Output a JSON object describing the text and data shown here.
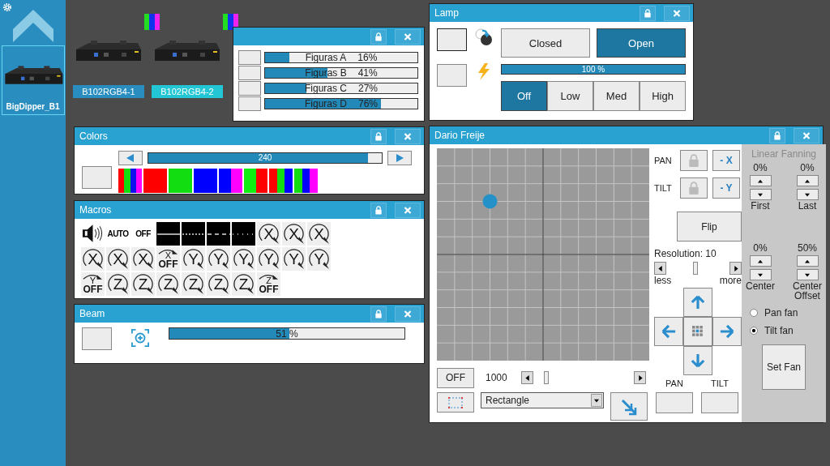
{
  "sidebar": {
    "items": [
      {
        "label": "BigDipper_B1",
        "selected": true
      }
    ]
  },
  "fixtures": [
    {
      "label": "B102RGB4-1",
      "selected": false,
      "stripes": [
        {
          "color": "#22dd22"
        },
        {
          "color": "#1133ee"
        },
        {
          "color": "#ee22ee"
        }
      ]
    },
    {
      "label": "B102RGB4-2",
      "selected": true,
      "stripes": [
        {
          "color": "#22dd22"
        },
        {
          "color": "#1133ee"
        },
        {
          "color": "#ee22ee"
        }
      ]
    }
  ],
  "figures_window": {
    "rows": [
      {
        "label": "Figuras A",
        "reading": "16%",
        "level": 0.16
      },
      {
        "label": "Figuras B",
        "reading": "41%",
        "level": 0.41
      },
      {
        "label": "Figuras C",
        "reading": "27%",
        "level": 0.27
      },
      {
        "label": "Figuras D",
        "reading": "76%",
        "level": 0.76
      }
    ]
  },
  "lamp_window": {
    "title": "Lamp",
    "shutter": [
      {
        "label": "Closed",
        "selected": false
      },
      {
        "label": "Open",
        "selected": true
      }
    ],
    "intensity": {
      "reading": "100 %",
      "level": 1.0
    },
    "power": [
      {
        "label": "Off",
        "selected": true
      },
      {
        "label": "Low",
        "selected": false
      },
      {
        "label": "Med",
        "selected": false
      },
      {
        "label": "High",
        "selected": false
      }
    ]
  },
  "colors_window": {
    "title": "Colors",
    "slider": {
      "reading": "240",
      "level": 0.94
    },
    "swatches": [
      {
        "stripes": [
          {
            "color": "#ff0000"
          },
          {
            "color": "#11dd11"
          },
          {
            "color": "#1111ee"
          },
          {
            "color": "#ff00ff"
          }
        ]
      },
      {
        "stripes": [
          {
            "color": "#ff0000"
          }
        ]
      },
      {
        "stripes": [
          {
            "color": "#11dd11"
          }
        ]
      },
      {
        "stripes": [
          {
            "color": "#0000ff"
          }
        ]
      },
      {
        "stripes": [
          {
            "color": "#0000ff"
          },
          {
            "color": "#ff00ff"
          }
        ]
      },
      {
        "stripes": [
          {
            "color": "#11ee11"
          },
          {
            "color": "#ff0000"
          }
        ]
      },
      {
        "stripes": [
          {
            "color": "#ff0000"
          },
          {
            "color": "#11dd11"
          },
          {
            "color": "#0000ff"
          }
        ]
      },
      {
        "stripes": [
          {
            "color": "#11dd11"
          },
          {
            "color": "#0000ff"
          },
          {
            "color": "#ff00ff"
          }
        ]
      }
    ]
  },
  "macros_window": {
    "title": "Macros",
    "items": [
      {
        "kind": "sound"
      },
      {
        "kind": "text",
        "label": "AUTO"
      },
      {
        "kind": "text",
        "label": "OFF"
      },
      {
        "kind": "line"
      },
      {
        "kind": "line"
      },
      {
        "kind": "line"
      },
      {
        "kind": "line"
      },
      {
        "kind": "rotate",
        "letter": "X"
      },
      {
        "kind": "rotate",
        "letter": "X"
      },
      {
        "kind": "rotate",
        "letter": "X"
      },
      {
        "kind": "rotate",
        "letter": "X"
      },
      {
        "kind": "rotate",
        "letter": "X"
      },
      {
        "kind": "rotate",
        "letter": "X"
      },
      {
        "kind": "rotate",
        "letter": "X",
        "caption": "OFF"
      },
      {
        "kind": "rotate",
        "letter": "Y"
      },
      {
        "kind": "rotate",
        "letter": "Y"
      },
      {
        "kind": "rotate",
        "letter": "Y"
      },
      {
        "kind": "rotate",
        "letter": "Y"
      },
      {
        "kind": "rotate",
        "letter": "Y"
      },
      {
        "kind": "rotate",
        "letter": "Y"
      },
      {
        "kind": "rotate",
        "letter": "Y",
        "caption": "OFF"
      },
      {
        "kind": "rotate",
        "letter": "Z"
      },
      {
        "kind": "rotate",
        "letter": "Z"
      },
      {
        "kind": "rotate",
        "letter": "Z"
      },
      {
        "kind": "rotate",
        "letter": "Z"
      },
      {
        "kind": "rotate",
        "letter": "Z"
      },
      {
        "kind": "rotate",
        "letter": "Z"
      },
      {
        "kind": "rotate",
        "letter": "Z",
        "caption": "OFF"
      }
    ]
  },
  "beam_window": {
    "title": "Beam",
    "reading": "51 %",
    "level": 0.51
  },
  "position_window": {
    "title": "Dario Freije",
    "pad": {
      "pan": {
        "level": 0.25
      },
      "tilt": {
        "level": 0.25
      }
    },
    "pan_label": "PAN",
    "tilt_label": "TILT",
    "invert_x": "- X",
    "invert_y": "- Y",
    "flip": "Flip",
    "resolution": {
      "label": "Resolution: 10",
      "level": 0.46,
      "less": "less",
      "more": "more"
    },
    "off_button": "OFF",
    "speed": {
      "reading": "1000",
      "level": 0.13
    },
    "shape": "Rectangle",
    "bottom_labels": [
      "PAN",
      "TILT"
    ],
    "fanning": {
      "title": "Linear Fanning",
      "spinners": [
        {
          "value": "0%",
          "label": "First"
        },
        {
          "value": "0%",
          "label": "Last"
        },
        {
          "value": "0%",
          "label": "Center"
        },
        {
          "value": "50%",
          "label": "Center Offset"
        }
      ],
      "radios": [
        {
          "label": "Pan fan",
          "selected": false
        },
        {
          "label": "Tilt fan",
          "selected": true
        }
      ],
      "button": "Set Fan"
    }
  }
}
